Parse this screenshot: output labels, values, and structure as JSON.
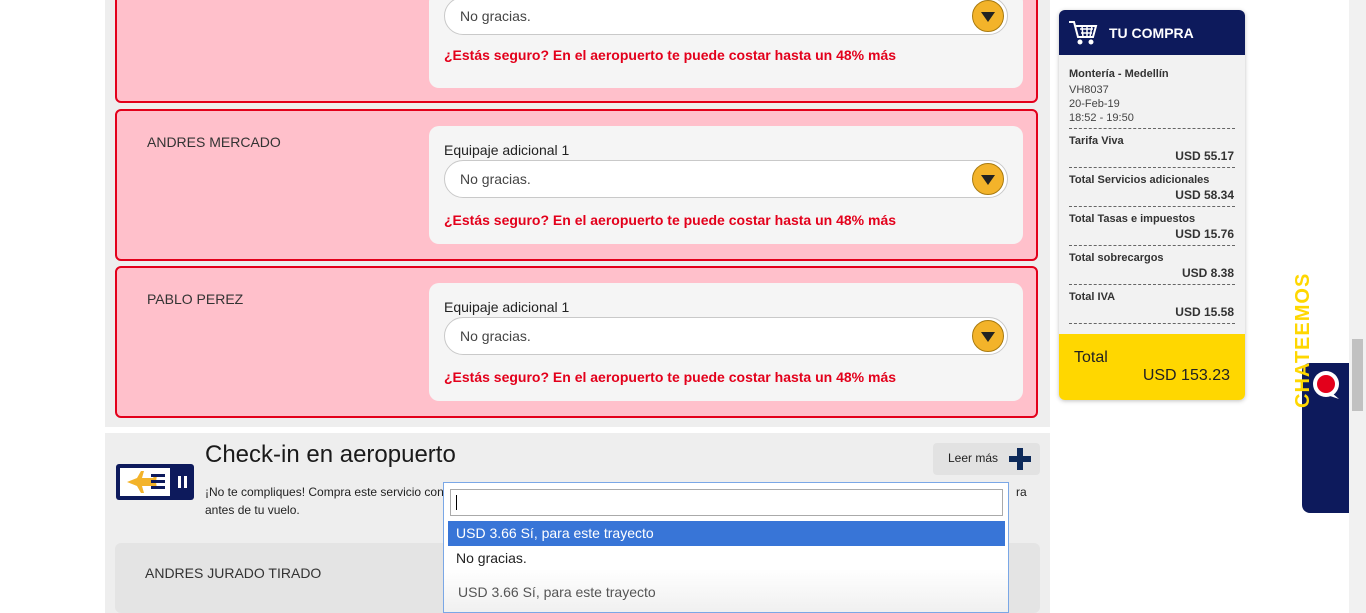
{
  "passengers_top": [
    {
      "name": "",
      "field_label": "",
      "value": "No gracias.",
      "warning": "¿Estás seguro? En el aeropuerto te puede costar hasta un 48% más"
    },
    {
      "name": "ANDRES MERCADO",
      "field_label": "Equipaje adicional 1",
      "value": "No gracias.",
      "warning": "¿Estás seguro? En el aeropuerto te puede costar hasta un 48% más"
    },
    {
      "name": "PABLO PEREZ",
      "field_label": "Equipaje adicional 1",
      "value": "No gracias.",
      "warning": "¿Estás seguro? En el aeropuerto te puede costar hasta un 48% más"
    }
  ],
  "checkin": {
    "title": "Check-in en aeropuerto",
    "desc_start": "¡No te compliques! Compra este servicio con",
    "desc_end": "ra",
    "desc_line2": "antes de tu vuelo.",
    "read_more": "Leer más",
    "passenger": "ANDRES JURADO TIRADO"
  },
  "dropdown": {
    "search_value": "",
    "options": [
      "USD 3.66 Sí, para este trayecto",
      "No gracias."
    ],
    "selected_index": 0,
    "current_value": "USD 3.66 Sí, para este trayecto"
  },
  "cart": {
    "title": "TU COMPRA",
    "route": "Montería - Medellín",
    "flight": "VH8037",
    "date": "20-Feb-19",
    "time": "18:52 - 19:50",
    "lines": [
      {
        "label": "Tarifa Viva",
        "value": "USD 55.17"
      },
      {
        "label": "Total Servicios adicionales",
        "value": "USD 58.34"
      },
      {
        "label": "Total Tasas e impuestos",
        "value": "USD 15.76"
      },
      {
        "label": "Total sobrecargos",
        "value": "USD 8.38"
      },
      {
        "label": "Total IVA",
        "value": "USD 15.58"
      }
    ],
    "total_label": "Total",
    "total_value": "USD 153.23"
  },
  "chat": {
    "label": "CHATEEMOS"
  },
  "colors": {
    "warning": "#e3001b",
    "navy": "#0d1a5c",
    "accent": "#ffd700",
    "pink": "#ffc0cb"
  }
}
